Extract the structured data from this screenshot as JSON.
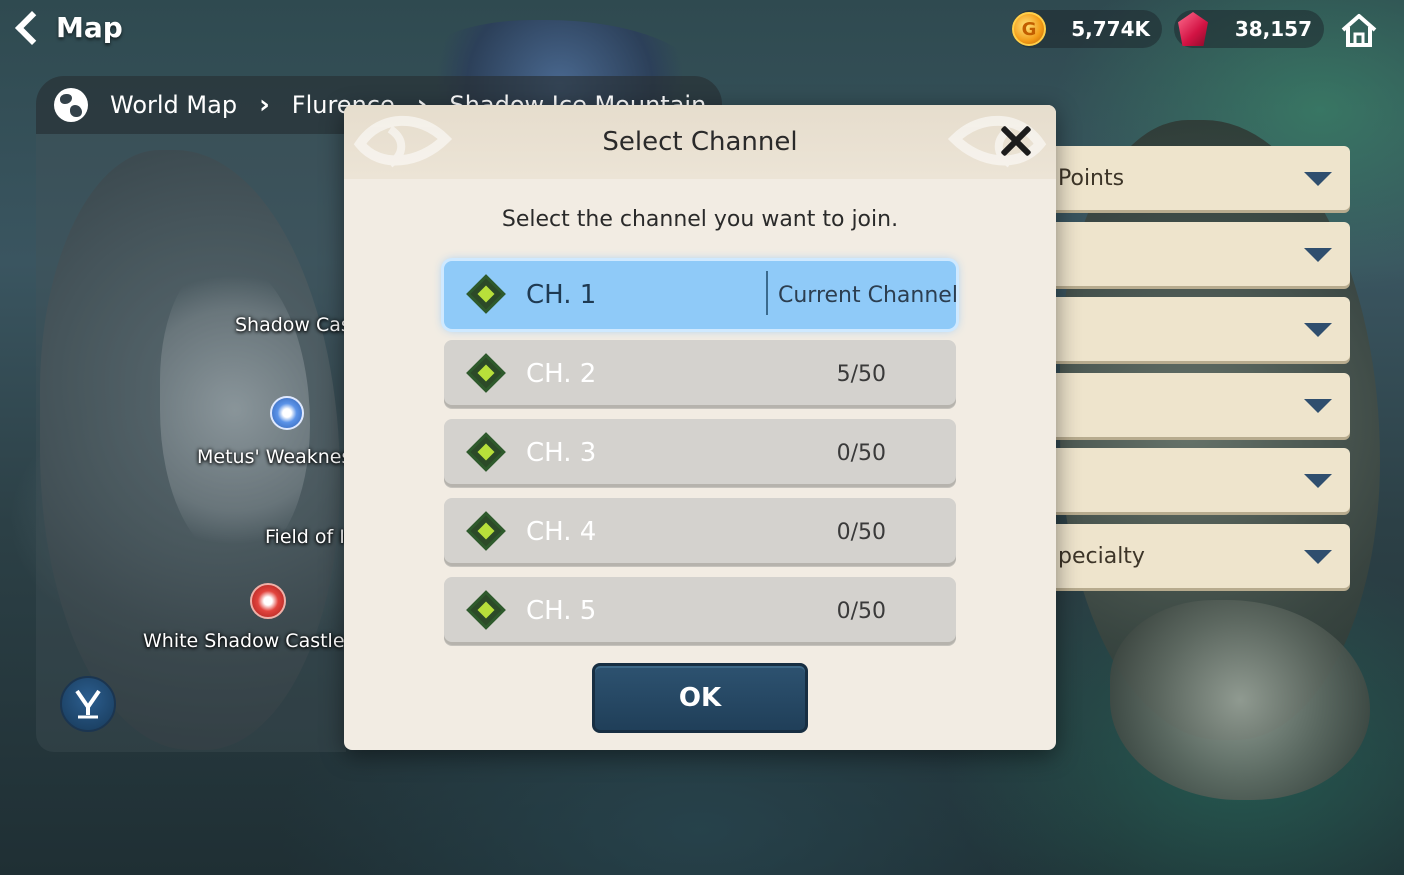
{
  "header": {
    "title": "Map",
    "gold_value": "5,774K",
    "gem_value": "38,157"
  },
  "breadcrumb": {
    "items": [
      "World Map",
      "Flurence",
      "Shadow Ice Mountain"
    ]
  },
  "map": {
    "labels": [
      "Shadow Cas",
      "Metus' Weakness",
      "Field of Ic",
      "White Shadow Castle W"
    ]
  },
  "filters": {
    "items": [
      "Points",
      "",
      "",
      "",
      "",
      "pecialty"
    ]
  },
  "modal": {
    "title": "Select Channel",
    "subtitle": "Select the channel you want to join.",
    "current_label": "Current Channel",
    "ok_label": "OK",
    "channels": [
      {
        "name": "CH. 1",
        "count": "",
        "current": true
      },
      {
        "name": "CH. 2",
        "count": "5/50",
        "current": false
      },
      {
        "name": "CH. 3",
        "count": "0/50",
        "current": false
      },
      {
        "name": "CH. 4",
        "count": "0/50",
        "current": false
      },
      {
        "name": "CH. 5",
        "count": "0/50",
        "current": false
      }
    ]
  },
  "colors": {
    "modal_bg": "#f2ece3",
    "current_channel": "#8fcaf8",
    "ok_button": "#2d5270",
    "filter_bg": "#eee4cc"
  }
}
